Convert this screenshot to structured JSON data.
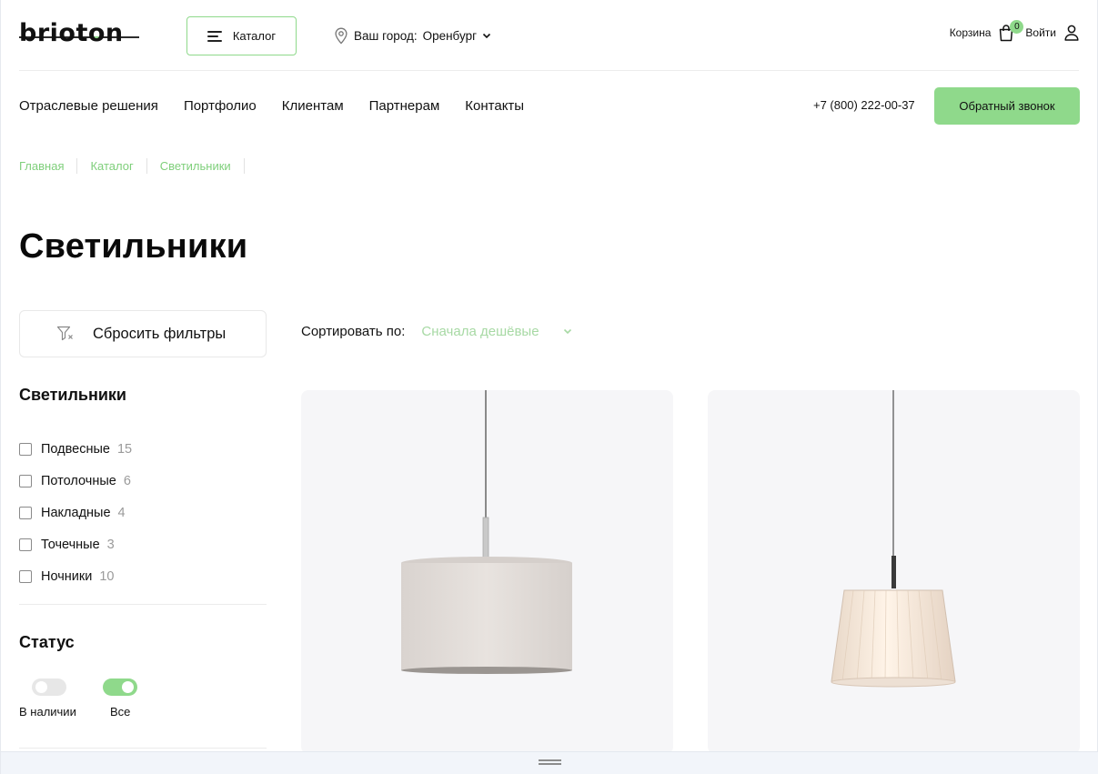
{
  "header": {
    "logo_text": "brioton",
    "catalog_label": "Каталог",
    "city_label": "Ваш город:",
    "city_value": "Оренбург",
    "cart_label": "Корзина",
    "cart_count": "0",
    "login_label": "Войти"
  },
  "nav": {
    "items": [
      "Отраслевые решения",
      "Портфолио",
      "Клиентам",
      "Партнерам",
      "Контакты"
    ],
    "phone": "+7 (800) 222-00-37",
    "callback_label": "Обратный звонок"
  },
  "breadcrumb": [
    "Главная",
    "Каталог",
    "Светильники"
  ],
  "page_title": "Светильники",
  "filters": {
    "reset_label": "Сбросить фильтры",
    "category_title": "Светильники",
    "categories": [
      {
        "label": "Подвесные",
        "count": "15"
      },
      {
        "label": "Потолочные",
        "count": "6"
      },
      {
        "label": "Накладные",
        "count": "4"
      },
      {
        "label": "Точечные",
        "count": "3"
      },
      {
        "label": "Ночники",
        "count": "10"
      }
    ],
    "status_title": "Статус",
    "status_options": [
      {
        "label": "В наличии",
        "on": false
      },
      {
        "label": "Все",
        "on": true
      }
    ]
  },
  "sort": {
    "label": "Сортировать по:",
    "value": "Сначала дешёвые"
  },
  "colors": {
    "accent": "#8fd98b",
    "accent_text": "#7fcf7b",
    "card_bg": "#f6f6f8"
  }
}
